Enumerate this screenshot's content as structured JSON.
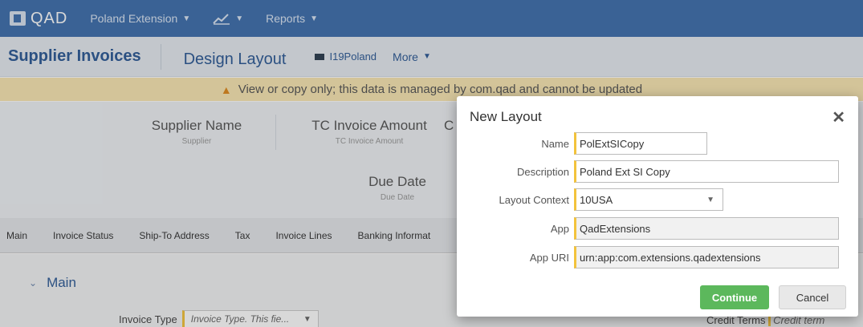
{
  "app": {
    "logo_text": "QAD",
    "nav": [
      "Poland Extension",
      "Reports"
    ]
  },
  "header": {
    "title": "Supplier Invoices",
    "subtitle": "Design Layout",
    "instance": "I19Poland",
    "more": "More"
  },
  "warning": "View or copy only; this data is managed by com.qad and cannot be updated",
  "summary": {
    "supplier_name": "Supplier  Name",
    "supplier_sub": "Supplier",
    "tc_amount": "TC Invoice Amount",
    "tc_amount_sub": "TC Invoice Amount",
    "tc_partial": "C",
    "due_date": "Due Date",
    "due_date_sub": "Due Date"
  },
  "tabs": [
    "Main",
    "Invoice Status",
    "Ship-To Address",
    "Tax",
    "Invoice Lines",
    "Banking Informat"
  ],
  "main_section": {
    "title": "Main",
    "invoice_type_label": "Invoice Type",
    "invoice_type_value": "Invoice Type. This fie...",
    "credit_terms_label": "Credit Terms",
    "credit_terms_value": "Credit term"
  },
  "modal": {
    "title": "New Layout",
    "fields": {
      "name_label": "Name",
      "name_value": "PolExtSICopy",
      "description_label": "Description",
      "description_value": "Poland Ext SI Copy",
      "context_label": "Layout Context",
      "context_value": "10USA",
      "app_label": "App",
      "app_value": "QadExtensions",
      "uri_label": "App URI",
      "uri_value": "urn:app:com.extensions.qadextensions"
    },
    "continue_label": "Continue",
    "cancel_label": "Cancel"
  },
  "colors": {
    "topbar": "#3f6fae",
    "warning_bg": "#f9e7b3",
    "required_marker": "#f3c33c",
    "continue_button": "#5cb85c"
  },
  "icons": {
    "logo": "qad-logo-icon",
    "chart": "line-chart-icon",
    "warning": "warning-icon",
    "close": "close-icon",
    "instance": "flag-icon"
  }
}
